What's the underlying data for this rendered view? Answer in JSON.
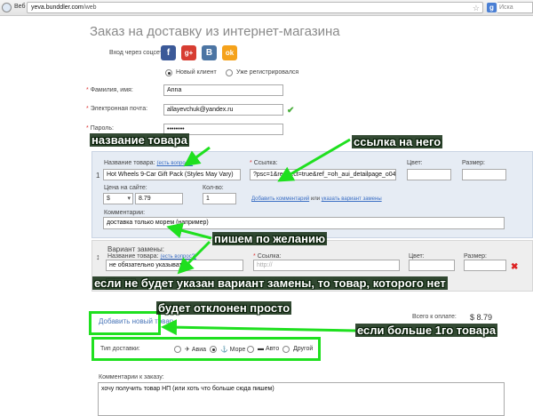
{
  "browser": {
    "tab_label": "Веб",
    "url_domain": "yeva.bunddler.com",
    "url_path": "/web",
    "search_placeholder": "Иска"
  },
  "page": {
    "title": "Заказ на доставку из интернет-магазина",
    "social_label": "Вход через соцсети:",
    "social": [
      {
        "name": "facebook",
        "glyph": "f",
        "color": "#3b5998"
      },
      {
        "name": "google-plus",
        "glyph": "g+",
        "color": "#d73d32"
      },
      {
        "name": "vkontakte",
        "glyph": "B",
        "color": "#4c75a3"
      },
      {
        "name": "odnoklassniki",
        "glyph": "ok",
        "color": "#f5a21b"
      }
    ],
    "client_type": {
      "new": "Новый клиент",
      "registered": "Уже регистрировался",
      "selected": "new"
    },
    "surname": {
      "label": "Фамилия, имя:",
      "value": "Anna"
    },
    "email": {
      "label": "Электронная почта:",
      "value": "allayevchuk@yandex.ru"
    },
    "password": {
      "label": "Пароль:",
      "value": "••••••••"
    }
  },
  "product": {
    "name_label": "Название товара:",
    "name_hint": "(есть вопрос?)",
    "name_value": "Hot Wheels 9-Car Gift Pack (Styles May Vary)",
    "row_number": "1",
    "link_label": "Ссылка:",
    "link_value": "?psc=1&redirect=true&ref_=oh_aui_detailpage_o04_s00",
    "color_label": "Цвет:",
    "size_label": "Размер:",
    "price_label": "Цена на сайте:",
    "currency": "$",
    "price_value": "8.79",
    "qty_label": "Кол-во:",
    "qty_value": "1",
    "add_comment_link": "Добавить комментарий",
    "or_text": "или",
    "replacement_link": "указать вариант замены",
    "comment_label": "Комментарии:",
    "comment_value": "доставка только морем (например)"
  },
  "replacement": {
    "title": "Вариант замены:",
    "arrow": "↕",
    "name_label": "Название товара:",
    "name_hint": "(есть вопрос?)",
    "name_value": "не обязательно указывать",
    "link_label": "Ссылка:",
    "link_placeholder": "http://",
    "color_label": "Цвет:",
    "size_label": "Размер:"
  },
  "order": {
    "add_item": "Добавить новый товар",
    "total_label": "Всего к оплате:",
    "total_value": "$ 8.79",
    "delivery_label": "Тип доставки:",
    "delivery_options": [
      "Авиа",
      "Море",
      "Авто",
      "Другой"
    ],
    "delivery_selected": "Море",
    "order_comment_label": "Комментарии к заказу:",
    "order_comment_value": "хочу получить товар НП  (или хоть что больше сюда пишем)"
  },
  "annotations": {
    "product_name": "название товара",
    "product_link": "ссылка на него",
    "by_wish": "пишем по желанию",
    "line1": "если не будет указан вариант замены, то товар, которого нет",
    "line2": "будет отклонен просто",
    "more_items": "если больше 1го товара"
  },
  "colors": {
    "annotation_green": "#1fe01f",
    "link_blue": "#3a6ec4",
    "panel_blue": "#e6ecf4"
  }
}
